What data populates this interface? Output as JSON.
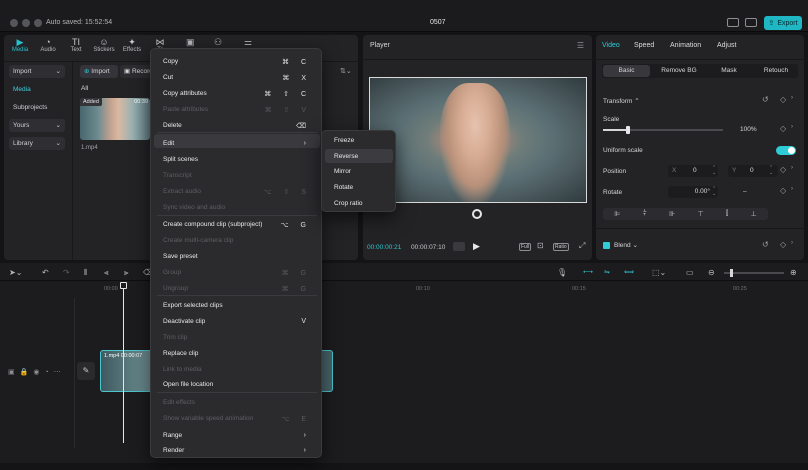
{
  "titlebar": {
    "autosave": "Auto saved: 15:52:54",
    "project_name": "0507",
    "export_label": "Export"
  },
  "toolbar": [
    {
      "label": "Media",
      "glyph": "▶"
    },
    {
      "label": "Audio",
      "glyph": "◔"
    },
    {
      "label": "Text",
      "glyph": "TI"
    },
    {
      "label": "Stickers",
      "glyph": "☺"
    },
    {
      "label": "Effects",
      "glyph": "✦"
    },
    {
      "label": "Tr",
      "glyph": "⋈"
    }
  ],
  "media": {
    "import_sidebar": "Import",
    "sidebar": [
      "Media",
      "Subprojects",
      "Yours",
      "Library"
    ],
    "import_button": "Import",
    "record_button": "Record",
    "filter_all": "All",
    "clip_badge": "Added",
    "clip_duration": "00:39",
    "clip_name": "1.mp4"
  },
  "player": {
    "title": "Player",
    "current_time": "00:00:00:21",
    "total_time": "00:00:07:10",
    "full_label": "Full",
    "ratio_label": "Ratio"
  },
  "properties": {
    "tabs": [
      "Video",
      "Speed",
      "Animation",
      "Adjust"
    ],
    "subtabs": [
      "Basic",
      "Remove BG",
      "Mask",
      "Retouch"
    ],
    "transform_label": "Transform",
    "scale_label": "Scale",
    "scale_value": "100%",
    "scale_fraction": 0.2,
    "uniform_scale_label": "Uniform scale",
    "position_label": "Position",
    "pos_x_label": "X",
    "pos_x": "0",
    "pos_y_label": "Y",
    "pos_y": "0",
    "rotate_label": "Rotate",
    "rotate_value": "0.00°",
    "rotate_dash": "–",
    "blend_label": "Blend"
  },
  "context_menu": {
    "items": [
      {
        "label": "Copy",
        "shortcut": "⌘ C",
        "enabled": true
      },
      {
        "label": "Cut",
        "shortcut": "⌘ X",
        "enabled": true
      },
      {
        "label": "Copy attributes",
        "shortcut": "⌘ ⇧ C",
        "enabled": true
      },
      {
        "label": "Paste attributes",
        "shortcut": "⌘ ⇧ V",
        "enabled": false
      },
      {
        "label": "Delete",
        "shortcut": "⌫",
        "enabled": true
      },
      {
        "label": "Edit",
        "shortcut": "›",
        "enabled": true
      },
      {
        "label": "Split scenes",
        "shortcut": "",
        "enabled": true
      },
      {
        "label": "Transcript",
        "shortcut": "",
        "enabled": false
      },
      {
        "label": "Extract audio",
        "shortcut": "⌥ ⇧ S",
        "enabled": false
      },
      {
        "label": "Sync video and audio",
        "shortcut": "",
        "enabled": false
      },
      {
        "label": "Create compound clip (subproject)",
        "shortcut": "⌥ G",
        "enabled": true
      },
      {
        "label": "Create multi-camera clip",
        "shortcut": "",
        "enabled": false
      },
      {
        "label": "Save preset",
        "shortcut": "",
        "enabled": true
      },
      {
        "label": "Group",
        "shortcut": "⌘ G",
        "enabled": false
      },
      {
        "label": "Ungroup",
        "shortcut": "⌘ G",
        "enabled": false
      },
      {
        "label": "Export selected clips",
        "shortcut": "",
        "enabled": true
      },
      {
        "label": "Deactivate clip",
        "shortcut": "V",
        "enabled": true
      },
      {
        "label": "Trim clip",
        "shortcut": "",
        "enabled": false
      },
      {
        "label": "Replace clip",
        "shortcut": "",
        "enabled": true
      },
      {
        "label": "Link to media",
        "shortcut": "",
        "enabled": false
      },
      {
        "label": "Open file location",
        "shortcut": "",
        "enabled": true
      },
      {
        "label": "Edit effects",
        "shortcut": "",
        "enabled": false
      },
      {
        "label": "Show variable speed animation",
        "shortcut": "⌥ E",
        "enabled": false
      },
      {
        "label": "Range",
        "shortcut": "›",
        "enabled": true
      },
      {
        "label": "Render",
        "shortcut": "›",
        "enabled": true
      }
    ]
  },
  "edit_submenu": {
    "items": [
      "Freeze",
      "Reverse",
      "Mirror",
      "Rotate",
      "Crop ratio"
    ]
  },
  "timeline": {
    "ticks": [
      "00:00",
      "00:10",
      "00:15",
      "00:20",
      "00:25"
    ],
    "clip_label": "1.mp4",
    "clip_time": "00:00:07"
  }
}
